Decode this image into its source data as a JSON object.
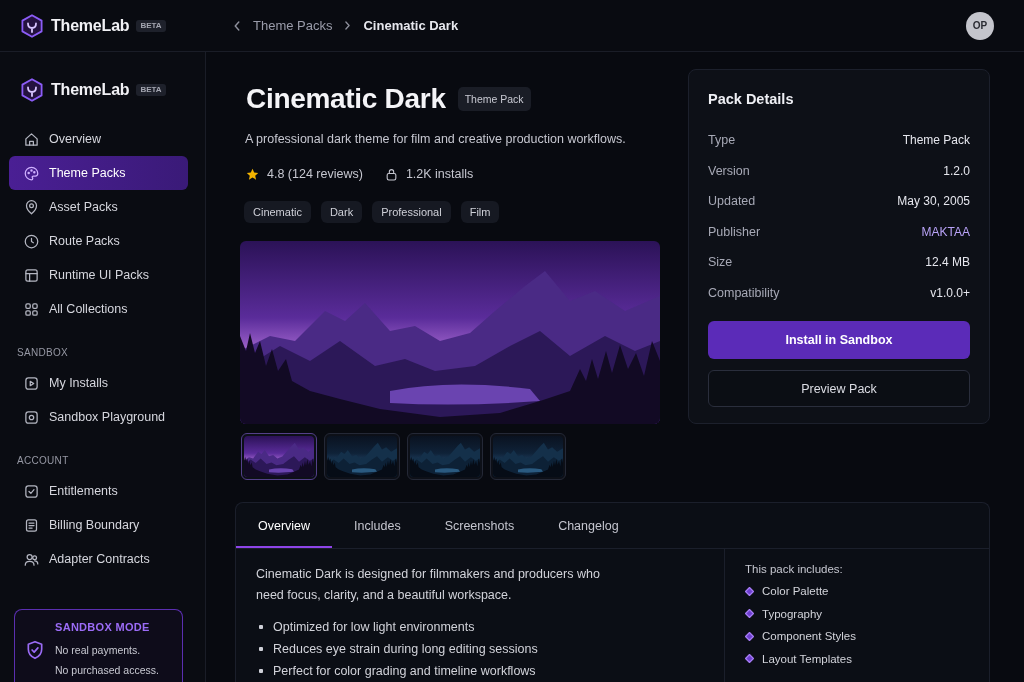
{
  "topbar": {
    "logo": {
      "name": "ThemeLab",
      "badge": "BETA"
    },
    "breadcrumb": [
      "Theme Packs",
      "Cinematic Dark"
    ],
    "avatar": "OP"
  },
  "sidebar": {
    "logo": {
      "name": "ThemeLab",
      "badge": "BETA"
    },
    "sections": [
      {
        "items": [
          {
            "label": "Overview",
            "selected": false
          },
          {
            "label": "Theme Packs",
            "selected": true
          },
          {
            "label": "Asset Packs",
            "selected": false
          },
          {
            "label": "Route Packs",
            "selected": false
          },
          {
            "label": "Runtime UI Packs",
            "selected": false
          },
          {
            "label": "All Collections",
            "selected": false
          }
        ]
      },
      {
        "heading": "SANDBOX",
        "items": [
          {
            "label": "My Installs",
            "selected": false
          },
          {
            "label": "Sandbox Playground",
            "selected": false
          }
        ]
      },
      {
        "heading": "ACCOUNT",
        "items": [
          {
            "label": "Entitlements",
            "selected": false
          },
          {
            "label": "Billing Boundary",
            "selected": false
          },
          {
            "label": "Adapter Contracts",
            "selected": false
          }
        ]
      }
    ],
    "notice": {
      "title": "SANDBOX MODE",
      "lines": [
        "No real payments.",
        "No purchased access."
      ]
    }
  },
  "pack": {
    "title": "Cinematic Dark",
    "badge": "Theme Pack",
    "description": "A professional dark theme for film and creative production workflows.",
    "rating": "4.8 (124 reviews)",
    "installs": "1.2K installs",
    "tags": [
      "Cinematic",
      "Dark",
      "Professional",
      "Film"
    ]
  },
  "gallery": {
    "thumbnails": [
      {
        "selected": true
      },
      {
        "selected": false
      },
      {
        "selected": false
      },
      {
        "selected": false
      }
    ]
  },
  "details": {
    "title": "Pack Details",
    "rows": [
      {
        "label": "Type",
        "value": "Theme Pack",
        "kind": "text"
      },
      {
        "label": "Version",
        "value": "1.2.0",
        "kind": "text"
      },
      {
        "label": "Updated",
        "value": "May 30, 2005",
        "kind": "text"
      },
      {
        "label": "Publisher",
        "value": "MAKTAA",
        "kind": "link"
      },
      {
        "label": "Size",
        "value": "12.4 MB",
        "kind": "text"
      },
      {
        "label": "Compatibility",
        "value": "v1.0.0+",
        "kind": "text"
      }
    ],
    "buttons": [
      {
        "label": "Install in Sandbox",
        "kind": "primary"
      },
      {
        "label": "Preview Pack",
        "kind": "secondary"
      }
    ]
  },
  "tabs": [
    {
      "label": "Overview",
      "selected": true
    },
    {
      "label": "Includes",
      "selected": false
    },
    {
      "label": "Screenshots",
      "selected": false
    },
    {
      "label": "Changelog",
      "selected": false
    }
  ],
  "overview": {
    "paragraph": "Cinematic Dark is designed for filmmakers and producers who need focus, clarity, and a beautiful workspace.",
    "bullets": [
      "Optimized for low light environments",
      "Reduces eye strain during long editing sessions",
      "Perfect for color grading and timeline workflows"
    ],
    "includes": {
      "heading": "This pack includes:",
      "items": [
        "Color Palette",
        "Typography",
        "Component Styles",
        "Layout Templates"
      ]
    }
  }
}
